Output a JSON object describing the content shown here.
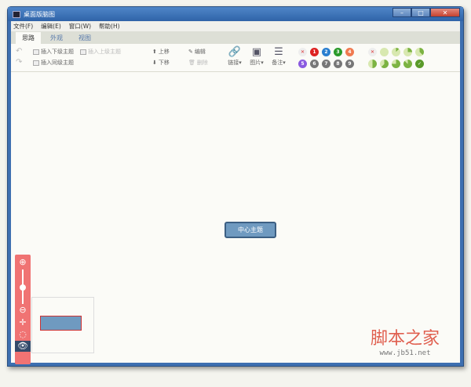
{
  "window": {
    "title": "桌面版脑图"
  },
  "menu": [
    "文件(F)",
    "编辑(E)",
    "窗口(W)",
    "帮助(H)"
  ],
  "tabs": [
    "思路",
    "外观",
    "视图"
  ],
  "ribbon": {
    "insert_child": "插入下级主题",
    "insert_parent": "插入上级主题",
    "insert_sibling": "插入同级主题",
    "move_up": "上移",
    "move_down": "下移",
    "edit": "编辑",
    "delete": "删除",
    "link": "链接",
    "image": "图片",
    "note": "备注"
  },
  "priorities": [
    "1",
    "2",
    "3",
    "4",
    "5",
    "6",
    "7",
    "8",
    "9"
  ],
  "canvas": {
    "central_topic": "中心主题"
  },
  "watermark": {
    "title": "脚本之家",
    "url": "www.jb51.net"
  }
}
